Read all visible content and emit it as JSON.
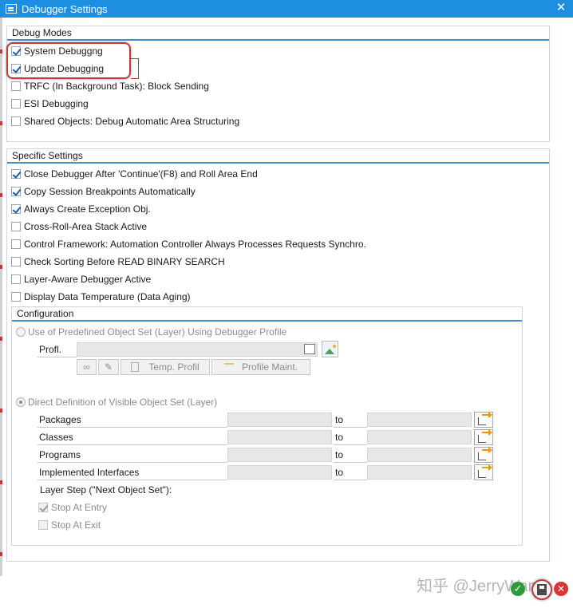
{
  "window": {
    "title": "Debugger Settings",
    "close_symbol": "✕"
  },
  "debug_modes": {
    "title": "Debug Modes",
    "items": [
      {
        "label": "System Debuggng",
        "checked": true
      },
      {
        "label": "Update Debugging",
        "checked": true
      },
      {
        "label": "TRFC (In Background Task): Block Sending",
        "checked": false
      },
      {
        "label": "ESI Debugging",
        "checked": false
      },
      {
        "label": "Shared Objects: Debug Automatic Area Structuring",
        "checked": false
      }
    ]
  },
  "specific_settings": {
    "title": "Specific Settings",
    "items": [
      {
        "label": "Close Debugger After 'Continue'(F8) and Roll Area End",
        "checked": true
      },
      {
        "label": "Copy Session Breakpoints Automatically",
        "checked": true
      },
      {
        "label": "Always Create Exception Obj.",
        "checked": true
      },
      {
        "label": "Cross-Roll-Area Stack Active",
        "checked": false
      },
      {
        "label": "Control Framework: Automation Controller Always Processes Requests Synchro.",
        "checked": false
      },
      {
        "label": "Check Sorting Before READ BINARY SEARCH",
        "checked": false
      },
      {
        "label": "Layer-Aware Debugger Active",
        "checked": false
      },
      {
        "label": "Display Data Temperature (Data Aging)",
        "checked": false
      }
    ]
  },
  "configuration": {
    "title": "Configuration",
    "predefined_radio": "Use of Predefined Object Set (Layer) Using Debugger Profile",
    "profile_label": "Profl.",
    "temp_profil_button": "Temp. Profil",
    "profile_maint_button": "Profile Maint.",
    "direct_radio": "Direct Definition of Visible Object Set (Layer)",
    "to_label": "to",
    "ranges": [
      {
        "label": "Packages"
      },
      {
        "label": "Classes"
      },
      {
        "label": "Programs"
      },
      {
        "label": "Implemented Interfaces"
      }
    ],
    "layer_step_label": "Layer Step (\"Next Object Set\"):",
    "stop_at_entry": "Stop At Entry",
    "stop_at_exit": "Stop At Exit"
  },
  "footer": {
    "watermark": "知乎 @JerryWang",
    "ok_symbol": "✓",
    "cancel_symbol": "✕"
  }
}
